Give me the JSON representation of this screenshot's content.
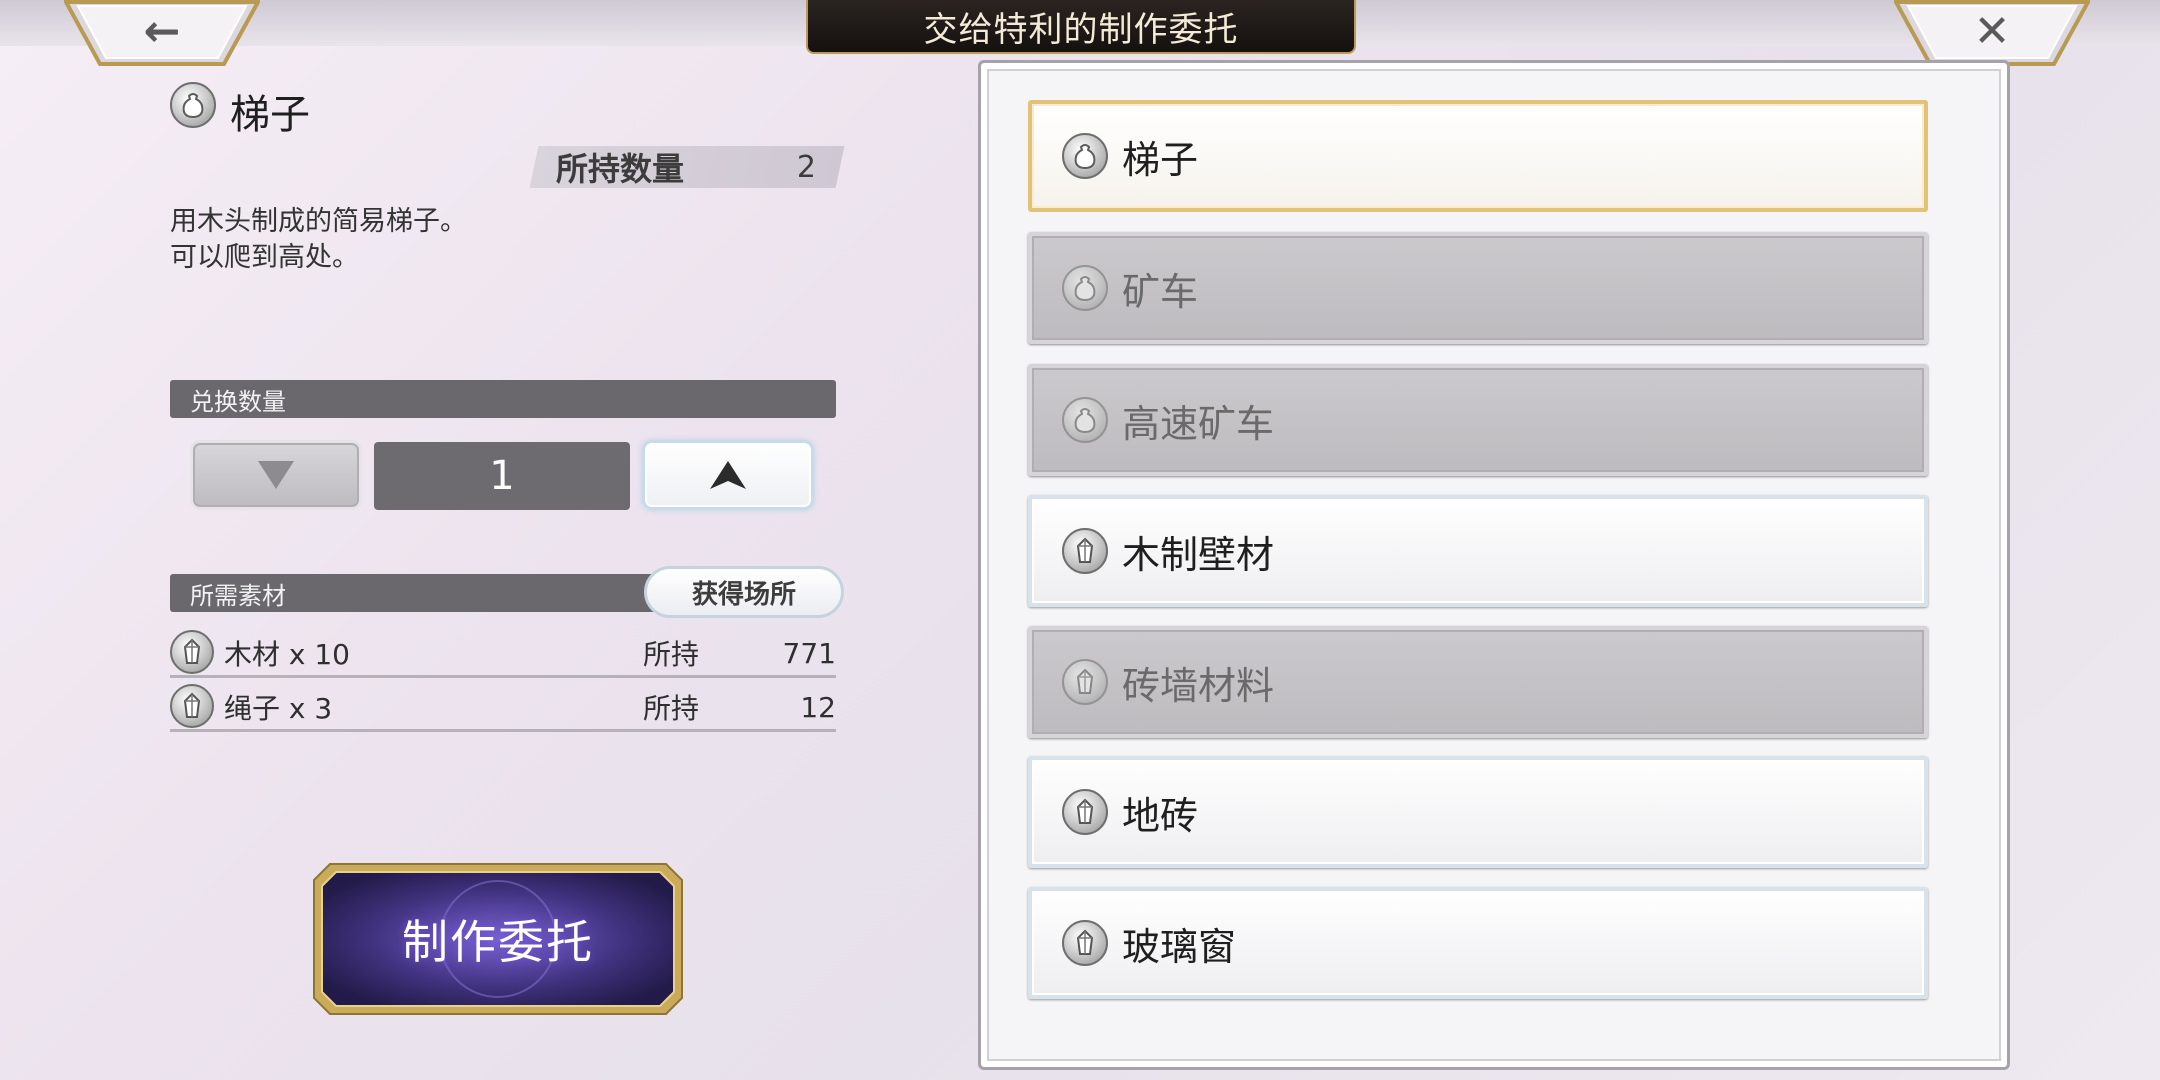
{
  "header": {
    "title": "交给特利的制作委托",
    "back_icon": "arrow-left-icon",
    "close_icon": "close-icon",
    "back_glyph": "←",
    "close_glyph": "✕"
  },
  "detail": {
    "item_name": "梯子",
    "owned_label": "所持数量",
    "owned_value": "2",
    "description_line1": "用木头制成的简易梯子。",
    "description_line2": "可以爬到高处。"
  },
  "exchange": {
    "section_label": "兑换数量",
    "quantity": "1",
    "decrease_icon": "triangle-down-icon",
    "increase_icon": "triangle-up-icon"
  },
  "materials": {
    "section_label": "所需素材",
    "source_button": "获得场所",
    "rows": [
      {
        "name": "木材 x 10",
        "owned_label": "所持",
        "count": "771"
      },
      {
        "name": "绳子 x 3",
        "owned_label": "所持",
        "count": "12"
      }
    ]
  },
  "actions": {
    "craft_label": "制作委托"
  },
  "recipe_list": [
    {
      "label": "梯子",
      "icon": "bag-icon",
      "state": "selected"
    },
    {
      "label": "矿车",
      "icon": "bag-icon",
      "state": "disabled"
    },
    {
      "label": "高速矿车",
      "icon": "bag-icon",
      "state": "disabled"
    },
    {
      "label": "木制壁材",
      "icon": "crystal-icon",
      "state": "normal"
    },
    {
      "label": "砖墙材料",
      "icon": "crystal-icon",
      "state": "disabled"
    },
    {
      "label": "地砖",
      "icon": "crystal-icon",
      "state": "normal"
    },
    {
      "label": "玻璃窗",
      "icon": "crystal-icon",
      "state": "normal"
    }
  ],
  "colors": {
    "selected_border": "#e1c277",
    "craft_button": "#3b2f7a",
    "title_plate": "#1e1815"
  }
}
